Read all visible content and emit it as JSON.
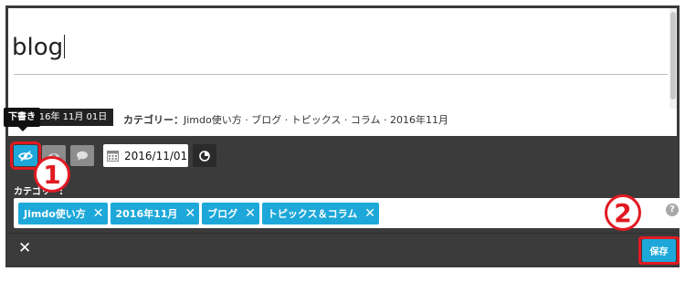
{
  "post": {
    "title": "blog",
    "date_label": "2016年 11月 01日",
    "category_prefix": "カテゴリー：",
    "category_text": "Jimdo使い方 · ブログ · トピックス · コラム · 2016年11月"
  },
  "toolbar": {
    "draft_tooltip": "下書き",
    "date_value": "2016/11/01",
    "icons": [
      "eye-slash-icon",
      "eye-icon",
      "comment-icon",
      "calendar-icon",
      "clock-icon"
    ]
  },
  "tags_section": {
    "label": "カテゴリー",
    "tags": [
      {
        "label": "Jimdo使い方"
      },
      {
        "label": "2016年11月"
      },
      {
        "label": "ブログ"
      },
      {
        "label": "トピックス＆コラム"
      }
    ],
    "help": "?"
  },
  "footer": {
    "close": "✕",
    "save_label": "保存"
  },
  "annotations": {
    "step1": "1",
    "step2": "2"
  },
  "colors": {
    "accent": "#1da8d9",
    "toolbar_bg": "#3b3b3b",
    "annotation_red": "#e11a22"
  }
}
